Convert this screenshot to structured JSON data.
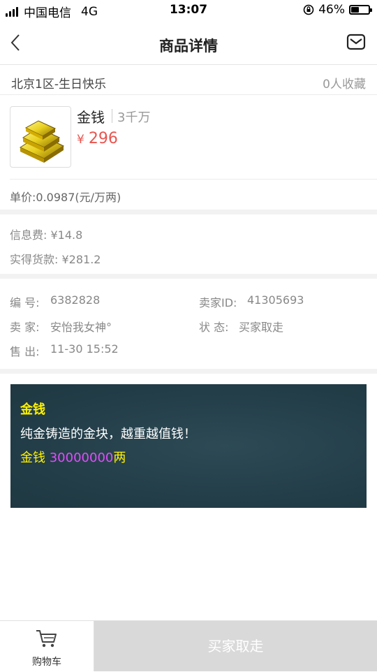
{
  "status_bar": {
    "carrier": "中国电信",
    "network": "4G",
    "time": "13:07",
    "battery": "46%",
    "battery_level": 0.46
  },
  "nav": {
    "title": "商品详情",
    "back_icon": "chevron-left-icon",
    "message_icon": "mail-icon"
  },
  "server": {
    "name": "北京1区-生日快乐",
    "favorites": "0人收藏"
  },
  "product": {
    "name": "金钱",
    "quantity": "3千万",
    "currency_symbol": "¥",
    "price": "296",
    "unit_price": "单价:0.0987(元/万两)"
  },
  "fees": {
    "info_fee": "信息费: ¥14.8",
    "received": "实得货款: ¥281.2"
  },
  "info": {
    "id_label": "编 号:",
    "id_value": "6382828",
    "seller_id_label": "卖家ID:",
    "seller_id_value": "41305693",
    "seller_label": "卖 家:",
    "seller_value": "安怡我女神°",
    "state_label": "状 态:",
    "state_value": "买家取走",
    "sold_label": "售 出:",
    "sold_value": "11-30 15:52"
  },
  "description": {
    "title": "金钱",
    "body": "纯金铸造的金块，越重越值钱！",
    "amount_prefix": "金钱 ",
    "amount_value": "30000000",
    "amount_suffix": "两"
  },
  "bottom_bar": {
    "cart_label": "购物车",
    "cart_icon": "shopping-cart-icon",
    "action_label": "买家取走"
  },
  "colors": {
    "price": "#e9554f",
    "desc_bg": "#233e49",
    "desc_highlight": "#fff200",
    "desc_number": "#e34bff",
    "action_disabled_bg": "#d9d9d9"
  }
}
